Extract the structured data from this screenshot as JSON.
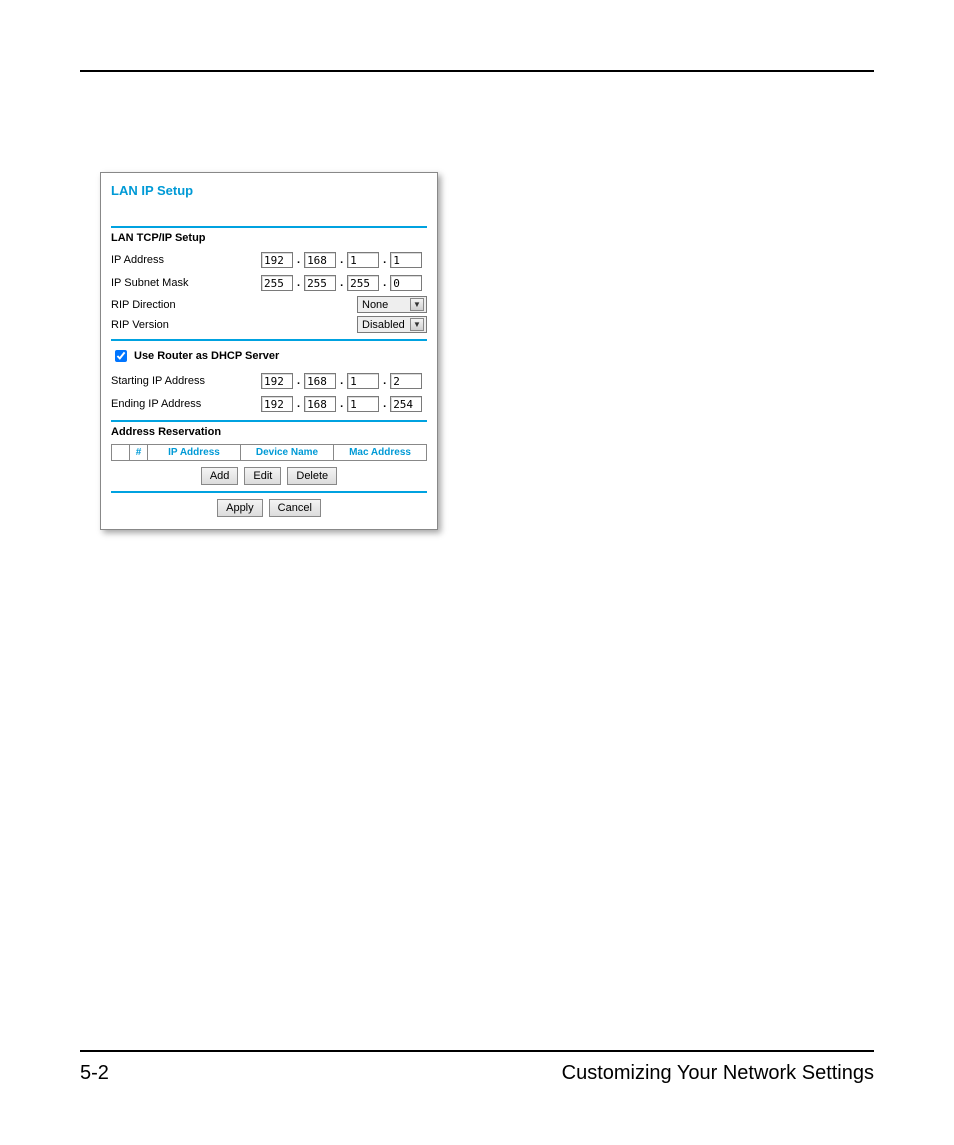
{
  "footer": {
    "page": "5-2",
    "title": "Customizing Your Network Settings"
  },
  "panel": {
    "title": "LAN IP Setup",
    "tcpip": {
      "heading": "LAN TCP/IP Setup",
      "ip_label": "IP Address",
      "ip": [
        "192",
        "168",
        "1",
        "1"
      ],
      "mask_label": "IP Subnet Mask",
      "mask": [
        "255",
        "255",
        "255",
        "0"
      ],
      "rip_dir_label": "RIP Direction",
      "rip_dir_value": "None",
      "rip_ver_label": "RIP Version",
      "rip_ver_value": "Disabled"
    },
    "dhcp": {
      "checkbox_label": "Use Router as DHCP Server",
      "checked": true,
      "start_label": "Starting IP Address",
      "start": [
        "192",
        "168",
        "1",
        "2"
      ],
      "end_label": "Ending IP Address",
      "end": [
        "192",
        "168",
        "1",
        "254"
      ]
    },
    "reservation": {
      "heading": "Address Reservation",
      "cols": {
        "num": "#",
        "ip": "IP Address",
        "name": "Device Name",
        "mac": "Mac Address"
      },
      "btn_add": "Add",
      "btn_edit": "Edit",
      "btn_delete": "Delete"
    },
    "btn_apply": "Apply",
    "btn_cancel": "Cancel"
  }
}
